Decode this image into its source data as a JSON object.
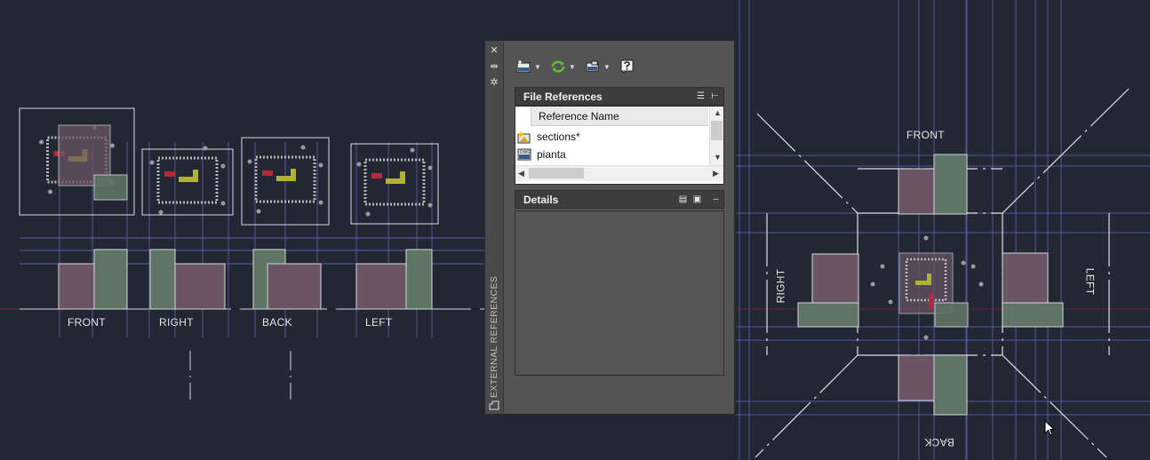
{
  "drawing": {
    "elevation_labels": [
      "FRONT",
      "RIGHT",
      "BACK",
      "LEFT"
    ],
    "plan_labels": {
      "front": "FRONT",
      "right": "RIGHT",
      "left": "LEFT",
      "back": "BACK"
    },
    "colors": {
      "background": "#212834",
      "grid_line": "#5a5fa8",
      "mass_purple": "#6b5565",
      "mass_green": "#5e7464",
      "highlight_yellow": "#b3b332",
      "highlight_red": "#b42a3a"
    }
  },
  "palette": {
    "title": "EXTERNAL REFERENCES",
    "titlebar_buttons": [
      "close-icon",
      "auto-hide-icon",
      "properties-icon"
    ],
    "toolbar": [
      "attach-dwg-icon",
      "refresh-icon",
      "change-path-icon",
      "help-icon"
    ],
    "file_references": {
      "title": "File References",
      "column_header": "Reference Name",
      "items": [
        {
          "name": "sections*",
          "icon": "xref-modified-icon"
        },
        {
          "name": "pianta",
          "icon": "dwg-file-icon"
        }
      ]
    },
    "details": {
      "title": "Details",
      "minimize": "–"
    }
  }
}
